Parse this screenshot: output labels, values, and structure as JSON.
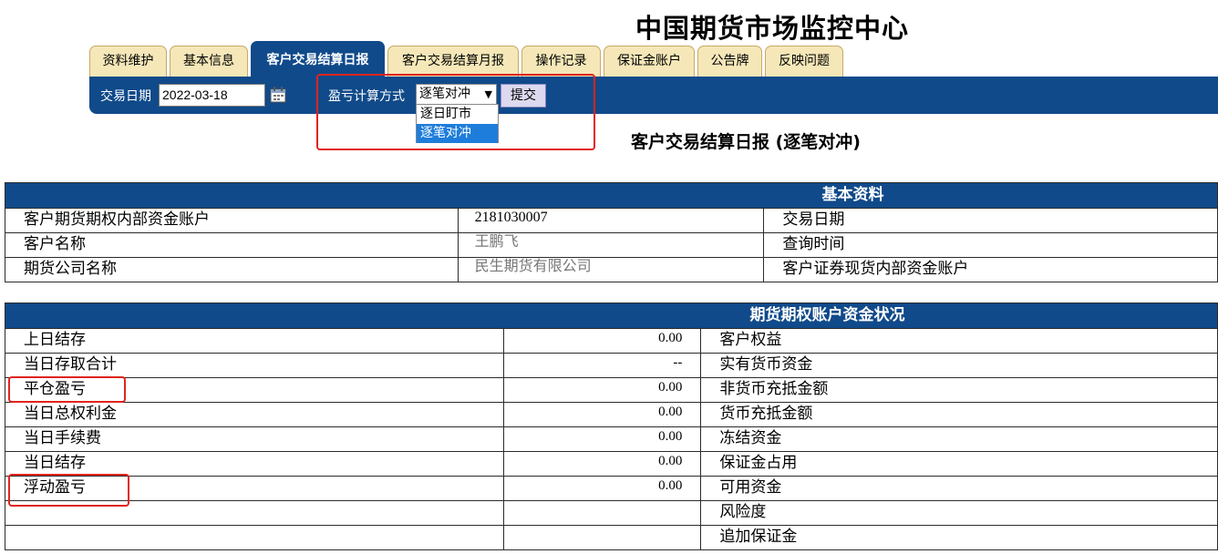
{
  "header": {
    "title": "中国期货市场监控中心"
  },
  "tabs": [
    {
      "label": "资料维护"
    },
    {
      "label": "基本信息"
    },
    {
      "label": "客户交易结算日报",
      "active": true
    },
    {
      "label": "客户交易结算月报"
    },
    {
      "label": "操作记录"
    },
    {
      "label": "保证金账户"
    },
    {
      "label": "公告牌"
    },
    {
      "label": "反映问题"
    }
  ],
  "toolbar": {
    "date_label": "交易日期",
    "date_value": "2022-03-18",
    "calendar_icon": "calendar-icon",
    "method_label": "盈亏计算方式",
    "method_value": "逐笔对冲",
    "method_options": [
      "逐日盯市",
      "逐笔对冲"
    ],
    "submit_label": "提交"
  },
  "report": {
    "title": "客户交易结算日报 (逐笔对冲)"
  },
  "basic_info": {
    "header": "基本资料",
    "rows": [
      {
        "label": "客户期货期权内部资金账户",
        "value": "2181030007",
        "right_label": "交易日期"
      },
      {
        "label": "客户名称",
        "value": "王鹏飞",
        "right_label": "查询时间"
      },
      {
        "label": "期货公司名称",
        "value": "民生期货有限公司",
        "right_label": "客户证券现货内部资金账户"
      }
    ]
  },
  "funds": {
    "header": "期货期权账户资金状况",
    "rows": [
      {
        "label": "上日结存",
        "value": "0.00",
        "right_label": "客户权益"
      },
      {
        "label": "当日存取合计",
        "value": "--",
        "right_label": "实有货币资金"
      },
      {
        "label": "平仓盈亏",
        "value": "0.00",
        "right_label": "非货币充抵金额"
      },
      {
        "label": "当日总权利金",
        "value": "0.00",
        "right_label": "货币充抵金额"
      },
      {
        "label": "当日手续费",
        "value": "0.00",
        "right_label": "冻结资金"
      },
      {
        "label": "当日结存",
        "value": "0.00",
        "right_label": "保证金占用"
      },
      {
        "label": "浮动盈亏",
        "value": "0.00",
        "right_label": "可用资金"
      },
      {
        "label": "",
        "value": "",
        "right_label": "风险度"
      },
      {
        "label": "",
        "value": "",
        "right_label": "追加保证金"
      }
    ]
  },
  "colors": {
    "brand_blue": "#104a8a",
    "tab_bg": "#f5e7b8",
    "highlight_red": "#e0241d",
    "option_selected": "#1e7ddb"
  }
}
